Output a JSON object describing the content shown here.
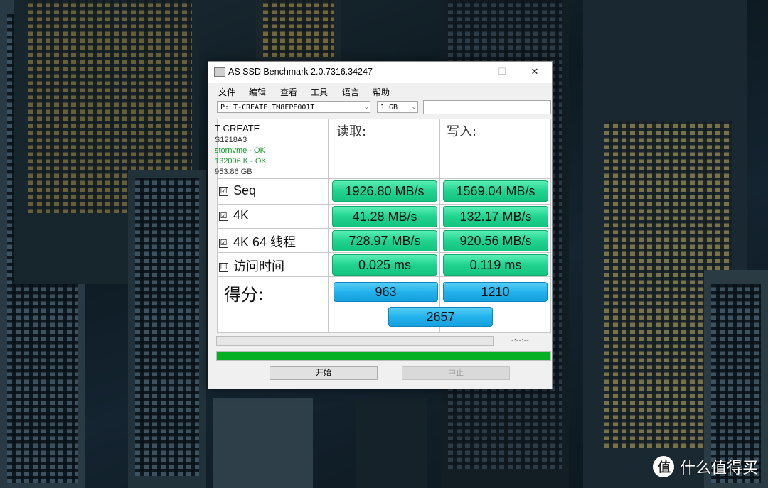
{
  "window": {
    "title": "AS SSD Benchmark 2.0.7316.34247"
  },
  "titlebar": {
    "minimize": "—",
    "maximize": "☐",
    "close": "✕"
  },
  "menu": [
    "文件",
    "编辑",
    "查看",
    "工具",
    "语言",
    "帮助"
  ],
  "drive": {
    "selected": "P: T-CREATE TM8FPE001T",
    "size": "1 GB",
    "text": ""
  },
  "info": {
    "model": "T-CREATE",
    "firmware": "S1218A3",
    "driver": "stornvme - OK",
    "alignment": "132096 K - OK",
    "capacity": "953.86 GB"
  },
  "headers": {
    "read": "读取:",
    "write": "写入:"
  },
  "rows": [
    {
      "label": "Seq",
      "checked": true,
      "read": "1926.80 MB/s",
      "write": "1569.04 MB/s"
    },
    {
      "label": "4K",
      "checked": true,
      "read": "41.28 MB/s",
      "write": "132.17 MB/s"
    },
    {
      "label": "4K 64 线程",
      "checked": true,
      "read": "728.97 MB/s",
      "write": "920.56 MB/s"
    },
    {
      "label": "访问时间",
      "checked": false,
      "read": "0.025 ms",
      "write": "0.119 ms"
    }
  ],
  "score": {
    "label": "得分:",
    "read": "963",
    "write": "1210",
    "total": "2657"
  },
  "status": {
    "time": "-:--:--",
    "progress": 1.0
  },
  "buttons": {
    "start": "开始",
    "stop": "中止"
  },
  "watermark": {
    "logo": "值",
    "text": "什么值得买"
  },
  "colors": {
    "green": "#20d38f",
    "blue": "#23b2ec",
    "progress": "#06b025"
  },
  "checkbox_glyph": {
    "checked": "☑",
    "unchecked": "☐"
  }
}
